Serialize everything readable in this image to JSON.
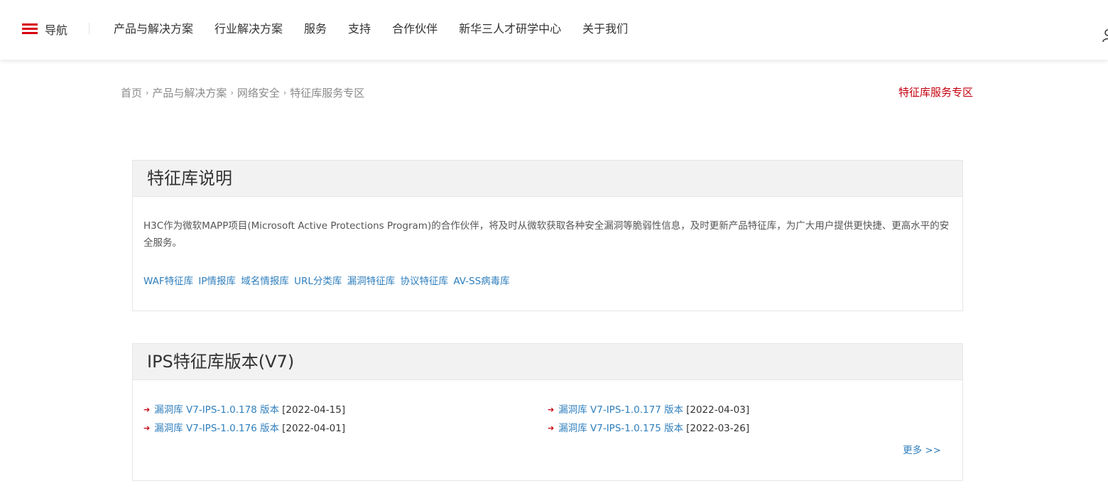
{
  "topnav": {
    "nav_label": "导航",
    "items": [
      "产品与解决方案",
      "行业解决方案",
      "服务",
      "支持",
      "合作伙伴",
      "新华三人才研学中心",
      "关于我们"
    ]
  },
  "breadcrumb": {
    "items": [
      "首页",
      "产品与解决方案",
      "网络安全",
      "特征库服务专区"
    ],
    "separator": "›"
  },
  "zone_link": "特征库服务专区",
  "desc_panel": {
    "title": "特征库说明",
    "text": "H3C作为微软MAPP项目(Microsoft Active Protections Program)的合作伙伴，将及时从微软获取各种安全漏洞等脆弱性信息，及时更新产品特征库，为广大用户提供更快捷、更高水平的安全服务。",
    "links": [
      "WAF特征库",
      "IP情报库",
      "域名情报库",
      "URL分类库",
      "漏洞特征库",
      "协议特征库",
      "AV-SS病毒库"
    ]
  },
  "ips_panel": {
    "title": "IPS特征库版本(V7)",
    "versions": [
      {
        "name": "漏洞库 V7-IPS-1.0.178 版本",
        "date": "[2022-04-15]"
      },
      {
        "name": "漏洞库 V7-IPS-1.0.177 版本",
        "date": "[2022-04-03]"
      },
      {
        "name": "漏洞库 V7-IPS-1.0.176 版本",
        "date": "[2022-04-01]"
      },
      {
        "name": "漏洞库 V7-IPS-1.0.175 版本",
        "date": "[2022-03-26]"
      }
    ],
    "more": "更多 >>"
  },
  "colors": {
    "accent_red": "#c4000f",
    "link_blue": "#2f7fbd",
    "panel_header_bg": "#f2f2f2"
  }
}
